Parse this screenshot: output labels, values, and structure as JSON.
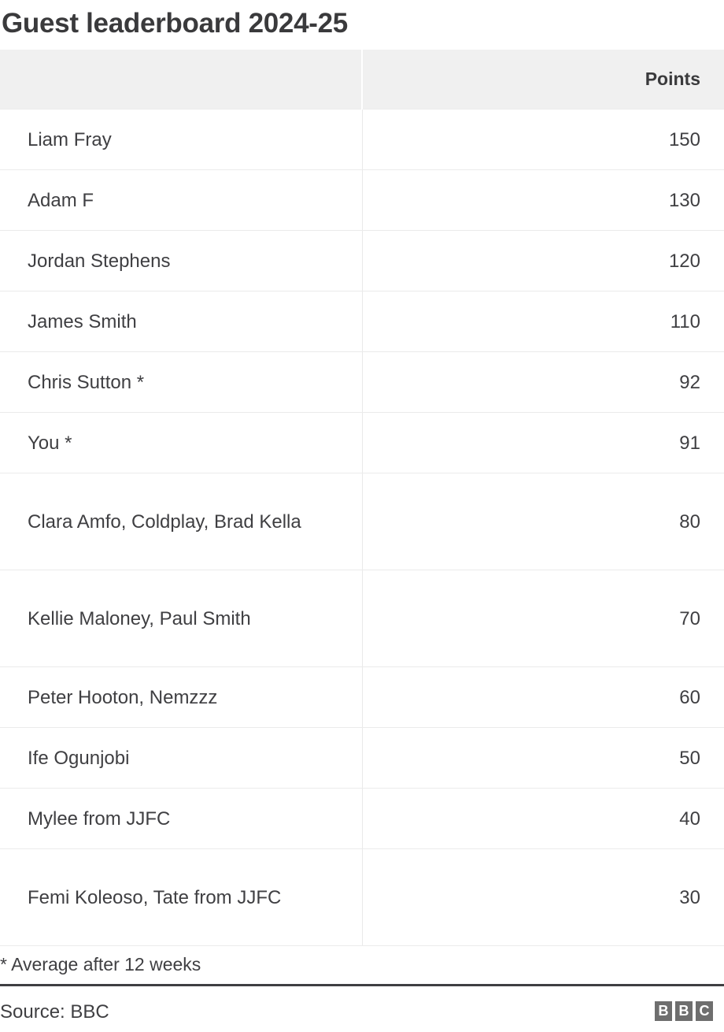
{
  "title": "Guest leaderboard 2024-25",
  "table": {
    "columns": [
      "",
      "Points"
    ],
    "rows": [
      {
        "name": "Liam Fray",
        "points": "150",
        "lines": 1
      },
      {
        "name": "Adam F",
        "points": "130",
        "lines": 1
      },
      {
        "name": "Jordan Stephens",
        "points": "120",
        "lines": 1
      },
      {
        "name": "James Smith",
        "points": "110",
        "lines": 1
      },
      {
        "name": "Chris Sutton *",
        "points": "92",
        "lines": 1
      },
      {
        "name": "You *",
        "points": "91",
        "lines": 1
      },
      {
        "name": "Clara Amfo, Coldplay, Brad Kella",
        "points": "80",
        "lines": 2
      },
      {
        "name": "Kellie Maloney, Paul Smith",
        "points": "70",
        "lines": 2
      },
      {
        "name": "Peter Hooton, Nemzzz",
        "points": "60",
        "lines": 1
      },
      {
        "name": "Ife Ogunjobi",
        "points": "50",
        "lines": 1
      },
      {
        "name": "Mylee from JJFC",
        "points": "40",
        "lines": 1
      },
      {
        "name": "Femi Koleoso, Tate from JJFC",
        "points": "30",
        "lines": 2
      }
    ]
  },
  "footnote": "* Average after 12 weeks",
  "footer": {
    "source": "Source: BBC",
    "logo_letters": [
      "B",
      "B",
      "C"
    ]
  },
  "colors": {
    "text": "#3f3f42",
    "title": "#3a3a3c",
    "header_bg": "#f0f0f0",
    "row_border": "#ebebeb",
    "footer_rule": "#3f3f42",
    "logo_bg": "#6e6e6e"
  },
  "chart_data": {
    "type": "table",
    "title": "Guest leaderboard 2024-25",
    "columns": [
      "",
      "Points"
    ],
    "categories": [
      "Liam Fray",
      "Adam F",
      "Jordan Stephens",
      "James Smith",
      "Chris Sutton *",
      "You *",
      "Clara Amfo, Coldplay, Brad Kella",
      "Kellie Maloney, Paul Smith",
      "Peter Hooton, Nemzzz",
      "Ife Ogunjobi",
      "Mylee from JJFC",
      "Femi Koleoso, Tate from JJFC"
    ],
    "values": [
      150,
      130,
      120,
      110,
      92,
      91,
      80,
      70,
      60,
      50,
      40,
      30
    ],
    "xlabel": "",
    "ylabel": "Points",
    "annotations": [
      "* Average after 12 weeks"
    ],
    "source": "Source: BBC"
  }
}
